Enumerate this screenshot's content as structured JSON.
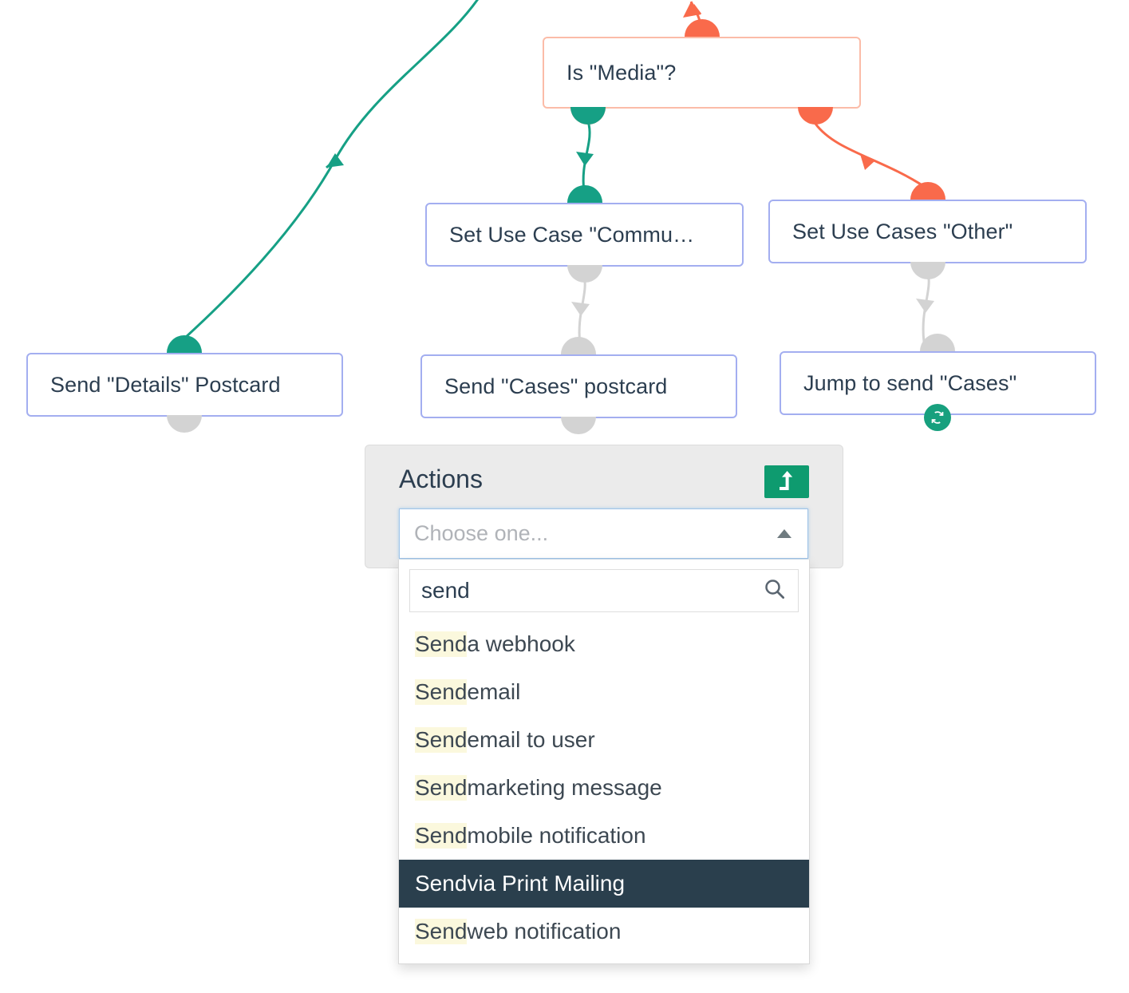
{
  "flow": {
    "nodes": [
      {
        "id": "is-media",
        "label": "Is \"Media\"?",
        "type": "decision"
      },
      {
        "id": "set-use-case-commu",
        "label": "Set Use Case \"Commu…",
        "type": "action"
      },
      {
        "id": "set-use-cases-other",
        "label": "Set Use Cases \"Other\"",
        "type": "action"
      },
      {
        "id": "send-details-postcard",
        "label": "Send \"Details\" Postcard",
        "type": "action"
      },
      {
        "id": "send-cases-postcard",
        "label": "Send \"Cases\" postcard",
        "type": "action"
      },
      {
        "id": "jump-to-send-cases",
        "label": "Jump to send \"Cases\"",
        "type": "action",
        "badge": "refresh-icon"
      }
    ],
    "colors": {
      "green": "#16a085",
      "orange": "#f96a4b",
      "grey": "#d3d3d3",
      "node_border": "#a3aef0",
      "decision_border": "#fbbca8",
      "badge_green": "#17a07e"
    }
  },
  "actions_panel": {
    "title": "Actions",
    "jump_button_icon": "jump-up-icon",
    "select": {
      "placeholder": "Choose one...",
      "value": "",
      "caret_icon": "caret-up-icon"
    }
  },
  "dropdown": {
    "search": {
      "value": "send",
      "placeholder": "",
      "icon": "search-icon"
    },
    "match_term": "Send",
    "options": [
      {
        "prefix": "Send",
        "rest": " a webhook",
        "selected": false
      },
      {
        "prefix": "Send",
        "rest": " email",
        "selected": false
      },
      {
        "prefix": "Send",
        "rest": " email to user",
        "selected": false
      },
      {
        "prefix": "Send",
        "rest": " marketing message",
        "selected": false
      },
      {
        "prefix": "Send",
        "rest": " mobile notification",
        "selected": false
      },
      {
        "prefix": "Send",
        "rest": " via Print Mailing",
        "selected": true
      },
      {
        "prefix": "Send",
        "rest": " web notification",
        "selected": false
      }
    ]
  }
}
